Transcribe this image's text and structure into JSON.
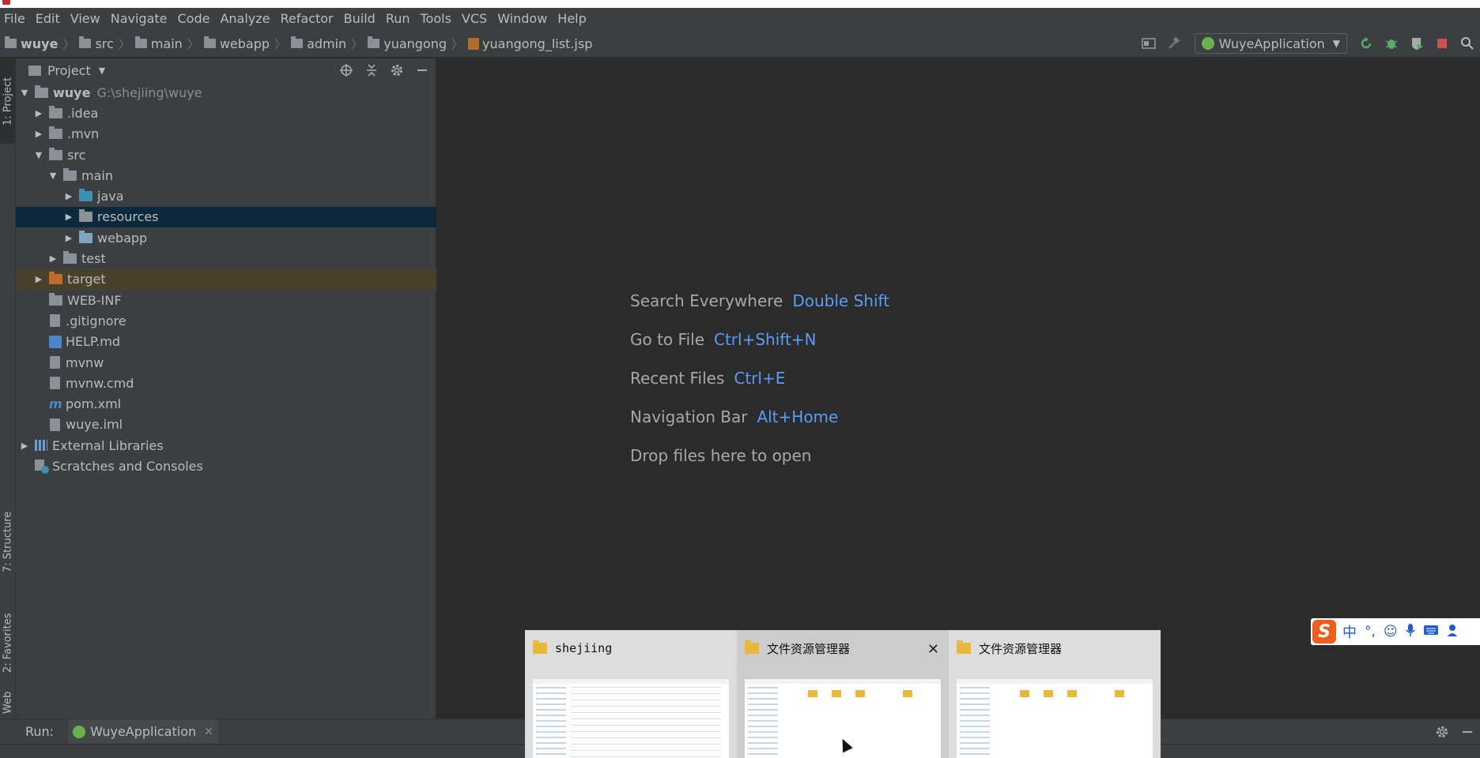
{
  "menu": [
    "File",
    "Edit",
    "View",
    "Navigate",
    "Code",
    "Analyze",
    "Refactor",
    "Build",
    "Run",
    "Tools",
    "VCS",
    "Window",
    "Help"
  ],
  "breadcrumb": [
    "wuye",
    "src",
    "main",
    "webapp",
    "admin",
    "yuangong",
    "yuangong_list.jsp"
  ],
  "run_config": "WuyeApplication",
  "side_tabs": {
    "project": "1: Project",
    "structure": "7: Structure",
    "favorites": "2: Favorites",
    "web": "Web"
  },
  "project_panel": {
    "title": "Project"
  },
  "tree": [
    {
      "name": "wuye",
      "path": "G:\\shejiing\\wuye"
    },
    {
      "name": ".idea"
    },
    {
      "name": ".mvn"
    },
    {
      "name": "src"
    },
    {
      "name": "main"
    },
    {
      "name": "java"
    },
    {
      "name": "resources"
    },
    {
      "name": "webapp"
    },
    {
      "name": "test"
    },
    {
      "name": "target"
    },
    {
      "name": "WEB-INF"
    },
    {
      "name": ".gitignore"
    },
    {
      "name": "HELP.md"
    },
    {
      "name": "mvnw"
    },
    {
      "name": "mvnw.cmd"
    },
    {
      "name": "pom.xml"
    },
    {
      "name": "wuye.iml"
    },
    {
      "name": "External Libraries"
    },
    {
      "name": "Scratches and Consoles"
    }
  ],
  "editor_hints": [
    {
      "text": "Search Everywhere",
      "key": "Double Shift"
    },
    {
      "text": "Go to File",
      "key": "Ctrl+Shift+N"
    },
    {
      "text": "Recent Files",
      "key": "Ctrl+E"
    },
    {
      "text": "Navigation Bar",
      "key": "Alt+Home"
    },
    {
      "text": "Drop files here to open",
      "key": ""
    }
  ],
  "run_bar": {
    "label": "Run:",
    "tab": "WuyeApplication"
  },
  "taskbar_thumbs": [
    "shejiing",
    "文件资源管理器",
    "文件资源管理器"
  ],
  "ime": {
    "logo": "S",
    "mode": "中",
    "punct": "°,"
  }
}
